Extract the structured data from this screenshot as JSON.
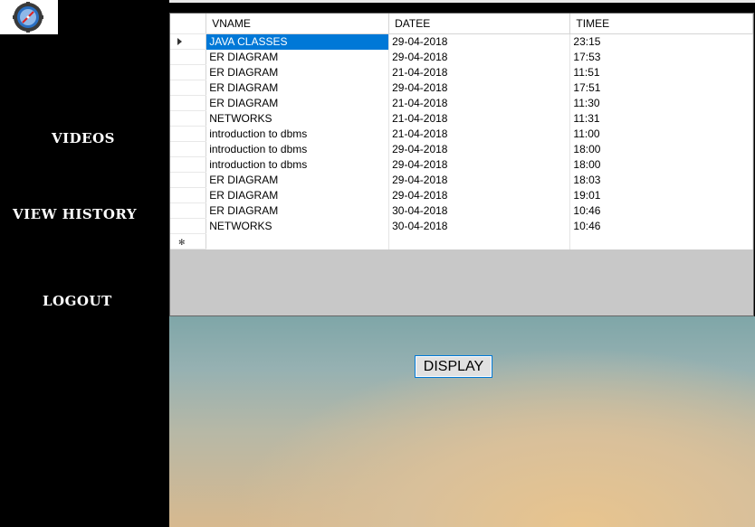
{
  "sidebar": {
    "items": [
      {
        "label": "VIDEOS"
      },
      {
        "label": "VIEW HISTORY"
      },
      {
        "label": "LOGOUT"
      }
    ]
  },
  "grid": {
    "columns": [
      "VNAME",
      "DATEE",
      "TIMEE"
    ],
    "selected_row": 0,
    "rows": [
      {
        "vname": "JAVA CLASSES",
        "datee": "29-04-2018",
        "timee": "23:15"
      },
      {
        "vname": "ER DIAGRAM",
        "datee": "29-04-2018",
        "timee": "17:53"
      },
      {
        "vname": "ER DIAGRAM",
        "datee": "21-04-2018",
        "timee": "11:51"
      },
      {
        "vname": "ER DIAGRAM",
        "datee": "29-04-2018",
        "timee": "17:51"
      },
      {
        "vname": "ER DIAGRAM",
        "datee": "21-04-2018",
        "timee": "11:30"
      },
      {
        "vname": "NETWORKS",
        "datee": "21-04-2018",
        "timee": "11:31"
      },
      {
        "vname": "introduction to dbms",
        "datee": "21-04-2018",
        "timee": "11:00"
      },
      {
        "vname": "introduction to dbms",
        "datee": "29-04-2018",
        "timee": "18:00"
      },
      {
        "vname": "introduction to dbms",
        "datee": "29-04-2018",
        "timee": "18:00"
      },
      {
        "vname": "ER DIAGRAM",
        "datee": "29-04-2018",
        "timee": "18:03"
      },
      {
        "vname": "ER DIAGRAM",
        "datee": "29-04-2018",
        "timee": "19:01"
      },
      {
        "vname": "ER DIAGRAM",
        "datee": "30-04-2018",
        "timee": "10:46"
      },
      {
        "vname": "NETWORKS",
        "datee": "30-04-2018",
        "timee": "10:46"
      }
    ]
  },
  "display_button": {
    "label": "DISPLAY"
  },
  "colors": {
    "selection": "#0078d7",
    "sidebar": "#000000",
    "grid_background": "#c8c8c8"
  },
  "icons": {
    "logo": "logo-compass-gear-icon",
    "current_row": "row-pointer-icon",
    "new_row": "new-row-icon"
  }
}
